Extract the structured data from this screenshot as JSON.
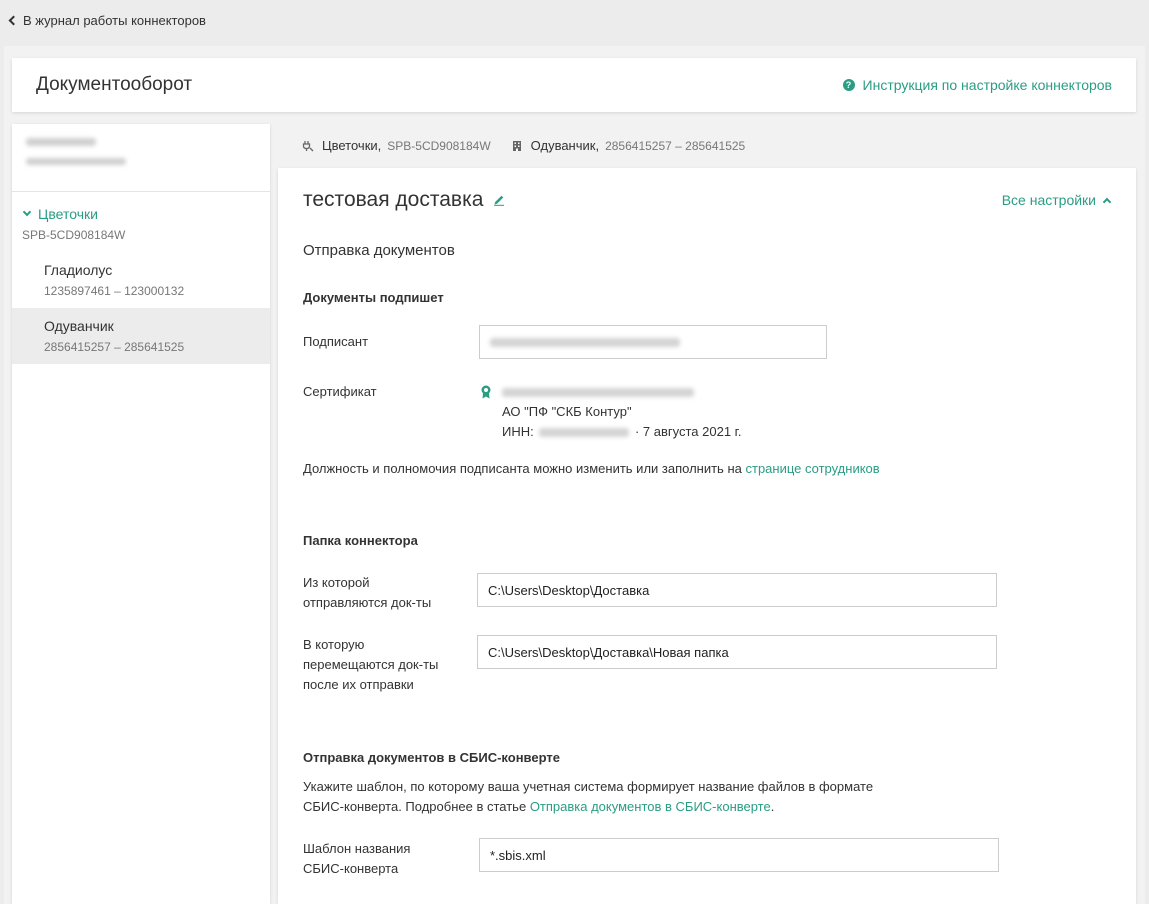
{
  "topbar": {
    "back_label": "В журнал работы коннекторов"
  },
  "header": {
    "title": "Документооборот",
    "help_link": "Инструкция по настройке коннекторов"
  },
  "sidebar": {
    "group": {
      "name": "Цветочки",
      "code": "SPB-5CD908184W"
    },
    "items": [
      {
        "name": "Гладиолус",
        "sub": "1235897461 – 123000132"
      },
      {
        "name": "Одуванчик",
        "sub": "2856415257 – 285641525"
      }
    ]
  },
  "crumbs": {
    "connector_name": "Цветочки,",
    "connector_code": "SPB-5CD908184W",
    "org_name": "Одуванчик,",
    "org_code": "2856415257 – 285641525"
  },
  "main": {
    "title": "тестовая доставка",
    "all_settings": "Все настройки",
    "section_title": "Отправка документов",
    "signers": {
      "heading": "Документы подпишет",
      "signer_label": "Подписант",
      "cert_label": "Сертификат",
      "cert_org": "АО \"ПФ \"СКБ Контур\"",
      "cert_inn_label": "ИНН:",
      "cert_date": "· 7 августа 2021 г.",
      "note_text": "Должность и полномочия подписанта можно изменить или заполнить на",
      "note_link": "странице сотрудников"
    },
    "folder": {
      "heading": "Папка коннектора",
      "from_label_1": "Из которой",
      "from_label_2": "отправляются док-ты",
      "from_value": "C:\\Users\\Desktop\\Доставка",
      "to_label_1": "В которую",
      "to_label_2": "перемещаются док-ты",
      "to_label_3": "после их отправки",
      "to_value": "C:\\Users\\Desktop\\Доставка\\Новая папка"
    },
    "sbis": {
      "heading": "Отправка документов в СБИС-конверте",
      "desc_1": "Укажите шаблон, по которому ваша учетная система формирует название файлов в формате",
      "desc_2": "СБИС-конверта. Подробнее в статье",
      "desc_link": "Отправка документов в СБИС-конверте",
      "desc_end": ".",
      "template_label_1": "Шаблон названия",
      "template_label_2": "СБИС-конверта",
      "template_value": "*.sbis.xml"
    }
  },
  "colors": {
    "accent": "#2a9d83",
    "background": "#ececec"
  }
}
